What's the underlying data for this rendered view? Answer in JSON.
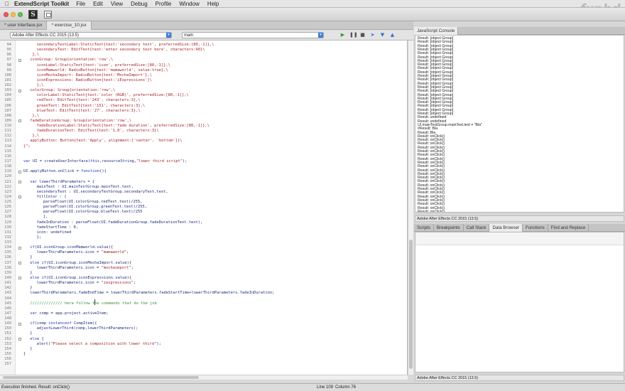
{
  "menubar": {
    "app_name": "ExtendScript Toolkit",
    "items": [
      "File",
      "Edit",
      "View",
      "Debug",
      "Profile",
      "Window",
      "Help"
    ]
  },
  "watermark": "fxphd",
  "tabs": [
    {
      "label": "* user interface.jsx",
      "active": false
    },
    {
      "label": "* exercise_10.jsx",
      "active": true
    }
  ],
  "target": {
    "app": "Adobe After Effects CC 2015 (13.5)",
    "function": "main"
  },
  "code_lines": [
    {
      "n": "94",
      "indent": 6,
      "t": "s",
      "text": "secondaryTextLabel:StaticText{text:'secondary text', preferredSize:[80,-1]},\\"
    },
    {
      "n": "95",
      "indent": 6,
      "t": "s",
      "text": "secondaryText: EditText{text:'enter secondary text here', characters:40}\\"
    },
    {
      "n": "96",
      "indent": 4,
      "t": "s",
      "text": "},\\"
    },
    {
      "n": "97",
      "indent": 3,
      "t": "s",
      "text": "iconGroup: Group{orientation:'row',\\"
    },
    {
      "n": "98",
      "indent": 6,
      "t": "s",
      "text": "iconLabel:StaticText{text:'icon', preferredSize:[80,-1]},\\"
    },
    {
      "n": "99",
      "indent": 6,
      "t": "s",
      "text": "iconMamworld: RadioButton{text:'mamaworld', value:true},\\"
    },
    {
      "n": "100",
      "indent": 6,
      "t": "s",
      "text": "iconMochaImport: RadioButton{text:'MochaImport'},\\"
    },
    {
      "n": "101",
      "indent": 6,
      "t": "s",
      "text": "iconExpressions: RadioButton{text:'iExpressions'}\\"
    },
    {
      "n": "102",
      "indent": 6,
      "t": "s",
      "text": "},\\"
    },
    {
      "n": "103",
      "indent": 3,
      "t": "s",
      "text": "colorGroup: Group{orientation:'row',\\"
    },
    {
      "n": "104",
      "indent": 6,
      "t": "s",
      "text": "colorLabel:StaticText{text:'color (RGB)', preferredSize:[80,-1]},\\"
    },
    {
      "n": "105",
      "indent": 6,
      "t": "s",
      "text": "redText: EditText{text:'243', characters:3},\\"
    },
    {
      "n": "106",
      "indent": 6,
      "t": "s",
      "text": "greenText: EditText{text:'151', characters:3},\\"
    },
    {
      "n": "107",
      "indent": 6,
      "t": "s",
      "text": "blueText: EditText{text:'27', characters:3},\\"
    },
    {
      "n": "108",
      "indent": 4,
      "t": "s",
      "text": "},\\"
    },
    {
      "n": "109",
      "indent": 3,
      "t": "s",
      "text": "fadeDurationGroup: Group{orientation:'row',\\"
    },
    {
      "n": "110",
      "indent": 6,
      "t": "s",
      "text": "fadeDurationLabel:StaticText{text:'fade duration', preferredSize:[80,-1]},\\"
    },
    {
      "n": "111",
      "indent": 6,
      "t": "s",
      "text": "fadeDurationText: EditText{text:'1.0', characters:3}\\"
    },
    {
      "n": "112",
      "indent": 4,
      "t": "s",
      "text": "},\\"
    },
    {
      "n": "113",
      "indent": 3,
      "t": "s",
      "text": "applyButton: Button{text:'Apply', alignment:['center', 'bottom']}\\"
    },
    {
      "n": "114",
      "indent": 0,
      "t": "s",
      "text": "}\";"
    },
    {
      "n": "115",
      "indent": 0,
      "t": "p",
      "text": ""
    },
    {
      "n": "116",
      "indent": 0,
      "t": "p",
      "text": ""
    },
    {
      "n": "117",
      "indent": 0,
      "t": "p",
      "text": "var UI = createUserInterface(this,resourceString,\"lower third script\");"
    },
    {
      "n": "118",
      "indent": 0,
      "t": "p",
      "text": ""
    },
    {
      "n": "119",
      "indent": 0,
      "t": "p",
      "text": "UI.applyButton.onClick = function(){"
    },
    {
      "n": "120",
      "indent": 0,
      "t": "p",
      "text": ""
    },
    {
      "n": "121",
      "indent": 3,
      "t": "p",
      "text": "var lowerThirdParameters = {"
    },
    {
      "n": "122",
      "indent": 6,
      "t": "p",
      "text": "mainText : UI.mainTextGroup.mainText.text,"
    },
    {
      "n": "123",
      "indent": 6,
      "t": "p",
      "text": "secondaryText : UI.secondaryTextGroup.secondaryText.text,"
    },
    {
      "n": "124",
      "indent": 6,
      "t": "p",
      "text": "fillColor : ["
    },
    {
      "n": "125",
      "indent": 9,
      "t": "p",
      "text": "parseFloat(UI.colorGroup.redText.text)/255,"
    },
    {
      "n": "126",
      "indent": 9,
      "t": "p",
      "text": "parseFloat(UI.colorGroup.greenText.text)/255,"
    },
    {
      "n": "127",
      "indent": 9,
      "t": "p",
      "text": "parseFloat(UI.colorGroup.blueText.text)/255"
    },
    {
      "n": "128",
      "indent": 9,
      "t": "p",
      "text": "],"
    },
    {
      "n": "129",
      "indent": 6,
      "t": "p",
      "text": "fadeInDuration : parseFloat(UI.fadeDurationGroup.fadeDurationText.text),"
    },
    {
      "n": "130",
      "indent": 6,
      "t": "p",
      "text": "fadeStartTime : 0,"
    },
    {
      "n": "131",
      "indent": 6,
      "t": "p",
      "text": "icon: undefined"
    },
    {
      "n": "132",
      "indent": 6,
      "t": "p",
      "text": "};"
    },
    {
      "n": "133",
      "indent": 0,
      "t": "p",
      "text": ""
    },
    {
      "n": "134",
      "indent": 3,
      "t": "p",
      "text": "if(UI.iconGroup.iconMamworld.value){"
    },
    {
      "n": "135",
      "indent": 6,
      "t": "p",
      "text": "lowerThirdParameters.icon = \"mamaworld\";"
    },
    {
      "n": "136",
      "indent": 3,
      "t": "p",
      "text": "}"
    },
    {
      "n": "137",
      "indent": 3,
      "t": "p",
      "text": "else if(UI.iconGroup.iconMochaImport.value){"
    },
    {
      "n": "138",
      "indent": 6,
      "t": "p",
      "text": "lowerThirdParameters.icon = \"mochaimport\";"
    },
    {
      "n": "139",
      "indent": 3,
      "t": "p",
      "text": "}"
    },
    {
      "n": "140",
      "indent": 3,
      "t": "p",
      "text": "else if(UI.iconGroup.iconExpressions.value){"
    },
    {
      "n": "141",
      "indent": 6,
      "t": "p",
      "text": "lowerThirdParameters.icon = \"iexpressions\";"
    },
    {
      "n": "142",
      "indent": 3,
      "t": "p",
      "text": "}"
    },
    {
      "n": "143",
      "indent": 3,
      "t": "p",
      "text": "lowerThirdParameters.fadeEndTime = lowerThirdParameters.fadeStartTime+lowerThirdParameters.fadeInDuration;"
    },
    {
      "n": "144",
      "indent": 0,
      "t": "p",
      "text": ""
    },
    {
      "n": "145",
      "indent": 3,
      "t": "c",
      "text": "////////////// here follow the commands that do the job"
    },
    {
      "n": "146",
      "indent": 0,
      "t": "p",
      "text": ""
    },
    {
      "n": "147",
      "indent": 3,
      "t": "p",
      "text": "var comp = app.project.activeItem;"
    },
    {
      "n": "148",
      "indent": 0,
      "t": "p",
      "text": ""
    },
    {
      "n": "149",
      "indent": 3,
      "t": "p",
      "text": "if(comp instanceof CompItem){"
    },
    {
      "n": "150",
      "indent": 6,
      "t": "p",
      "text": "adjustLowerThird(comp,lowerThirdParameters);"
    },
    {
      "n": "151",
      "indent": 3,
      "t": "p",
      "text": "}"
    },
    {
      "n": "152",
      "indent": 3,
      "t": "p",
      "text": "else {"
    },
    {
      "n": "153",
      "indent": 6,
      "t": "p",
      "text": "alert(\"Please select a composition with lower third\");"
    },
    {
      "n": "154",
      "indent": 3,
      "t": "p",
      "text": "}"
    },
    {
      "n": "155",
      "indent": 0,
      "t": "p",
      "text": "}"
    },
    {
      "n": "156",
      "indent": 0,
      "t": "p",
      "text": ""
    },
    {
      "n": "157",
      "indent": 0,
      "t": "p",
      "text": ""
    }
  ],
  "console": {
    "tab": "JavaScript Console",
    "lines": [
      "Result: [object Group]",
      "Result: [object Group]",
      "Result: [object Group]",
      "Result: [object Group]",
      "Result: [object Group]",
      "Result: [object Group]",
      "Result: [object Group]",
      "Result: [object Group]",
      "Result: [object Group]",
      "Result: [object Group]",
      "Result: [object Group]",
      "Result: [object Group]",
      "Result: [object Group]",
      "Result: [object Group]",
      "Result: [object Group]",
      "Result: [object Group]",
      "Result: [object Group]",
      "Result: [object Group]",
      "Result: [object Group]",
      "Result: [object Group]",
      "Result: [object Group]",
      "Result: undefined",
      "Result: undefined",
      "UI.mainTextGroup.mainText.text = \"Bla\"",
      "#Result: Bla",
      "Result: Bla",
      "Result: onClick()",
      "Result: onClick()",
      "Result: onClick()",
      "Result: onClick()",
      "Result: onClick()",
      "Result: onClick()",
      "Result: onClick()",
      "Result: onClick()",
      "Result: onClick()",
      "Result: onClick()",
      "Result: onClick()",
      "Result: onClick()",
      "Result: onClick()",
      "Result: onClick()",
      "Result: onClick()",
      "Result: onClick()",
      "Result: onClick()",
      "Result: onClick()",
      "Result: onClick()",
      "Result: onClick()",
      "Result: onClick()"
    ],
    "target": "Adobe After Effects CC 2015 (13.5)"
  },
  "debug_tabs": [
    {
      "label": "Scripts",
      "active": false
    },
    {
      "label": "Breakpoints",
      "active": false
    },
    {
      "label": "Call Stack",
      "active": false
    },
    {
      "label": "Data Browser",
      "active": true
    },
    {
      "label": "Functions",
      "active": false
    },
    {
      "label": "Find and Replace",
      "active": false
    }
  ],
  "right_status": "Adobe After Effects CC 2015 (13.5)",
  "status": {
    "message": "Execution finished. Result: onClick()",
    "line": "Line 109",
    "column": "Column 76"
  }
}
